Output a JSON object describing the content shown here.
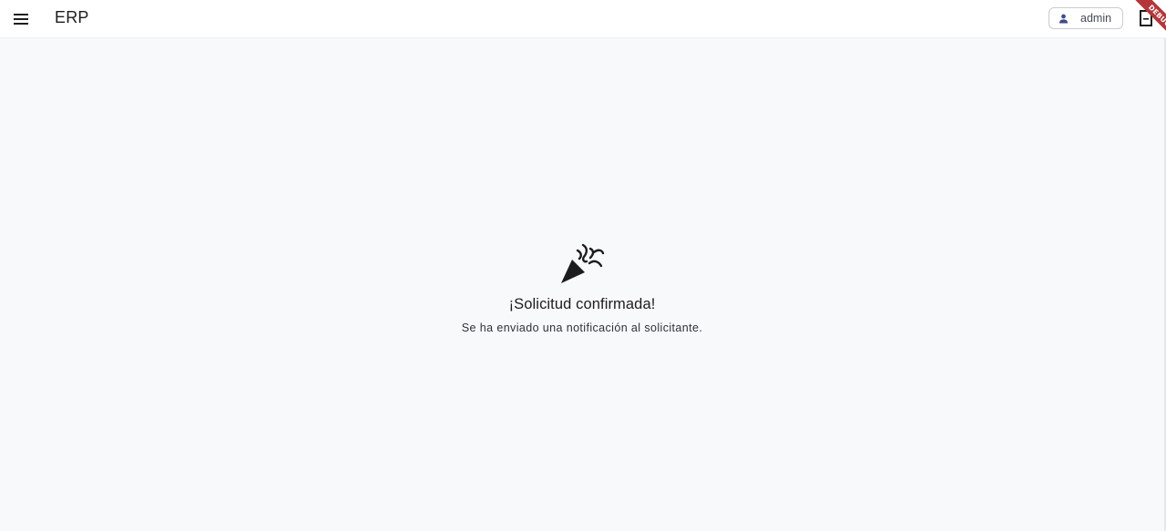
{
  "appbar": {
    "title": "ERP",
    "menu_icon": "menu-icon",
    "user_label": "admin",
    "user_icon": "person-icon",
    "document_icon": "document-icon",
    "debug_banner": "DEBUG"
  },
  "main": {
    "icon": "party-popper-icon",
    "title": "¡Solicitud confirmada!",
    "subtitle": "Se ha enviado una notificación al solicitante."
  },
  "colors": {
    "background": "#f8f9fb",
    "appbar": "#ffffff",
    "debug_ribbon": "#b5363a",
    "text": "#1c1c1e"
  }
}
